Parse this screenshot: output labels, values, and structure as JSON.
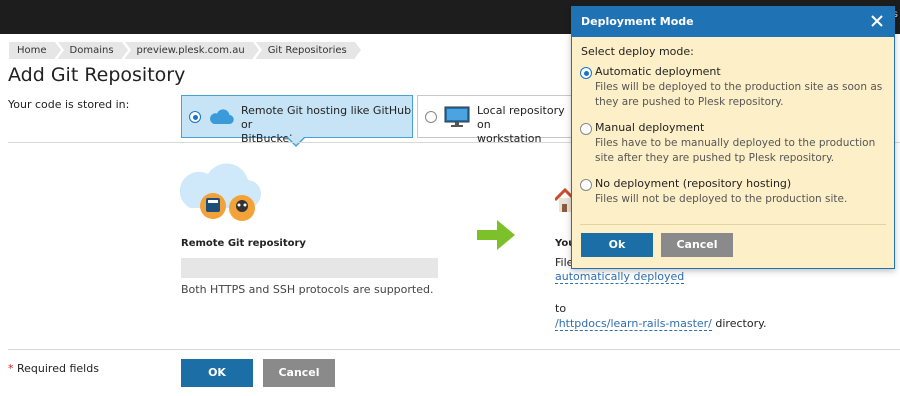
{
  "topbar": {
    "text": "s"
  },
  "breadcrumb": [
    "Home",
    "Domains",
    "preview.plesk.com.au",
    "Git Repositories"
  ],
  "page": {
    "title": "Add Git Repository",
    "stored_label": "Your code is stored in:",
    "choices": {
      "remote": {
        "label_line1": "Remote Git hosting like GitHub or",
        "label_line2": "BitBucket",
        "selected": true,
        "icon": "cloud-icon"
      },
      "local": {
        "label_line1": "Local repository on",
        "label_line2": "workstation",
        "selected": false,
        "icon": "monitor-icon"
      }
    },
    "remote_repo_label": "Remote Git repository",
    "remote_repo_value": "",
    "hint": "Both HTTPS and SSH protocols are supported.",
    "you_text": "You",
    "files_text": "File",
    "deploy_link": "automatically deployed",
    "to_text": "to",
    "dir_link": "/httpdocs/learn-rails-master/",
    "dir_suffix": " directory.",
    "required_text": "Required fields",
    "required_asterisk": "*",
    "ok_label": "OK",
    "cancel_label": "Cancel"
  },
  "dialog": {
    "title": "Deployment Mode",
    "prompt": "Select deploy mode:",
    "options": [
      {
        "label": "Automatic deployment",
        "desc": "Files will be deployed to the production site as soon as they are pushed to Plesk repository.",
        "selected": true
      },
      {
        "label": "Manual deployment",
        "desc": "Files have to be manually deployed to the production site after they are pushed tp Plesk repository.",
        "selected": false
      },
      {
        "label": "No deployment (repository hosting)",
        "desc": "Files will not be deployed to the production site.",
        "selected": false
      }
    ],
    "ok_label": "Ok",
    "cancel_label": "Cancel"
  },
  "colors": {
    "accent": "#1f73b5",
    "dialog_bg": "#fdf0c8",
    "selected_choice_bg": "#c7e4f6",
    "arrow_green": "#7cc12a",
    "link": "#2f6fb0"
  }
}
